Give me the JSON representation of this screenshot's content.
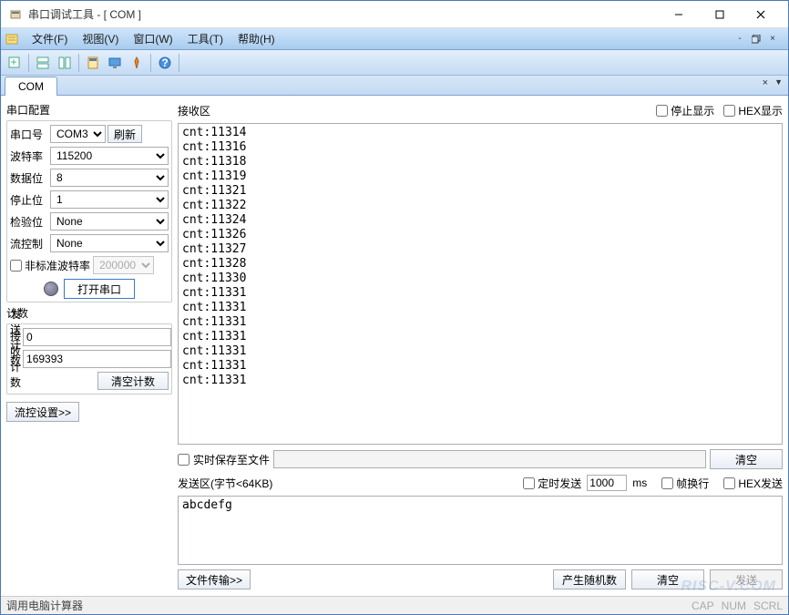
{
  "window": {
    "title": "串口调试工具 - [ COM ]"
  },
  "menubar": {
    "file": "文件(F)",
    "view": "视图(V)",
    "window": "窗口(W)",
    "tool": "工具(T)",
    "help": "帮助(H)"
  },
  "tab": {
    "label": "COM"
  },
  "config": {
    "title": "串口配置",
    "port_label": "串口号",
    "port_value": "COM3",
    "refresh": "刷新",
    "baud_label": "波特率",
    "baud_value": "115200",
    "data_label": "数据位",
    "data_value": "8",
    "stop_label": "停止位",
    "stop_value": "1",
    "parity_label": "检验位",
    "parity_value": "None",
    "flow_label": "流控制",
    "flow_value": "None",
    "nonstd_label": "非标准波特率",
    "nonstd_value": "200000",
    "open_btn": "打开串口"
  },
  "counter": {
    "title": "计数",
    "tx_label": "发送计数",
    "tx_value": "0",
    "rx_label": "接收计数",
    "rx_value": "169393",
    "clear_btn": "清空计数"
  },
  "flow_settings_btn": "流控设置>>",
  "recv": {
    "title": "接收区",
    "stop_display": "停止显示",
    "hex_display": "HEX显示",
    "lines": [
      "cnt:11314",
      "cnt:11316",
      "cnt:11318",
      "cnt:11319",
      "cnt:11321",
      "cnt:11322",
      "cnt:11324",
      "cnt:11326",
      "cnt:11327",
      "cnt:11328",
      "cnt:11330",
      "cnt:11331",
      "cnt:11331",
      "cnt:11331",
      "cnt:11331",
      "cnt:11331",
      "cnt:11331",
      "cnt:11331"
    ],
    "save_label": "实时保存至文件",
    "clear_btn": "清空"
  },
  "send": {
    "title": "发送区(字节<64KB)",
    "timed_label": "定时发送",
    "timed_value": "1000",
    "timed_unit": "ms",
    "wrap_label": "帧换行",
    "hex_label": "HEX发送",
    "content": "abcdefg",
    "file_btn": "文件传输>>",
    "rand_btn": "产生随机数",
    "clear_btn": "清空",
    "send_btn": "发送"
  },
  "status": {
    "text": "调用电脑计算器",
    "cap": "CAP",
    "num": "NUM",
    "scrl": "SCRL"
  },
  "watermark": "RISC-V.COM"
}
